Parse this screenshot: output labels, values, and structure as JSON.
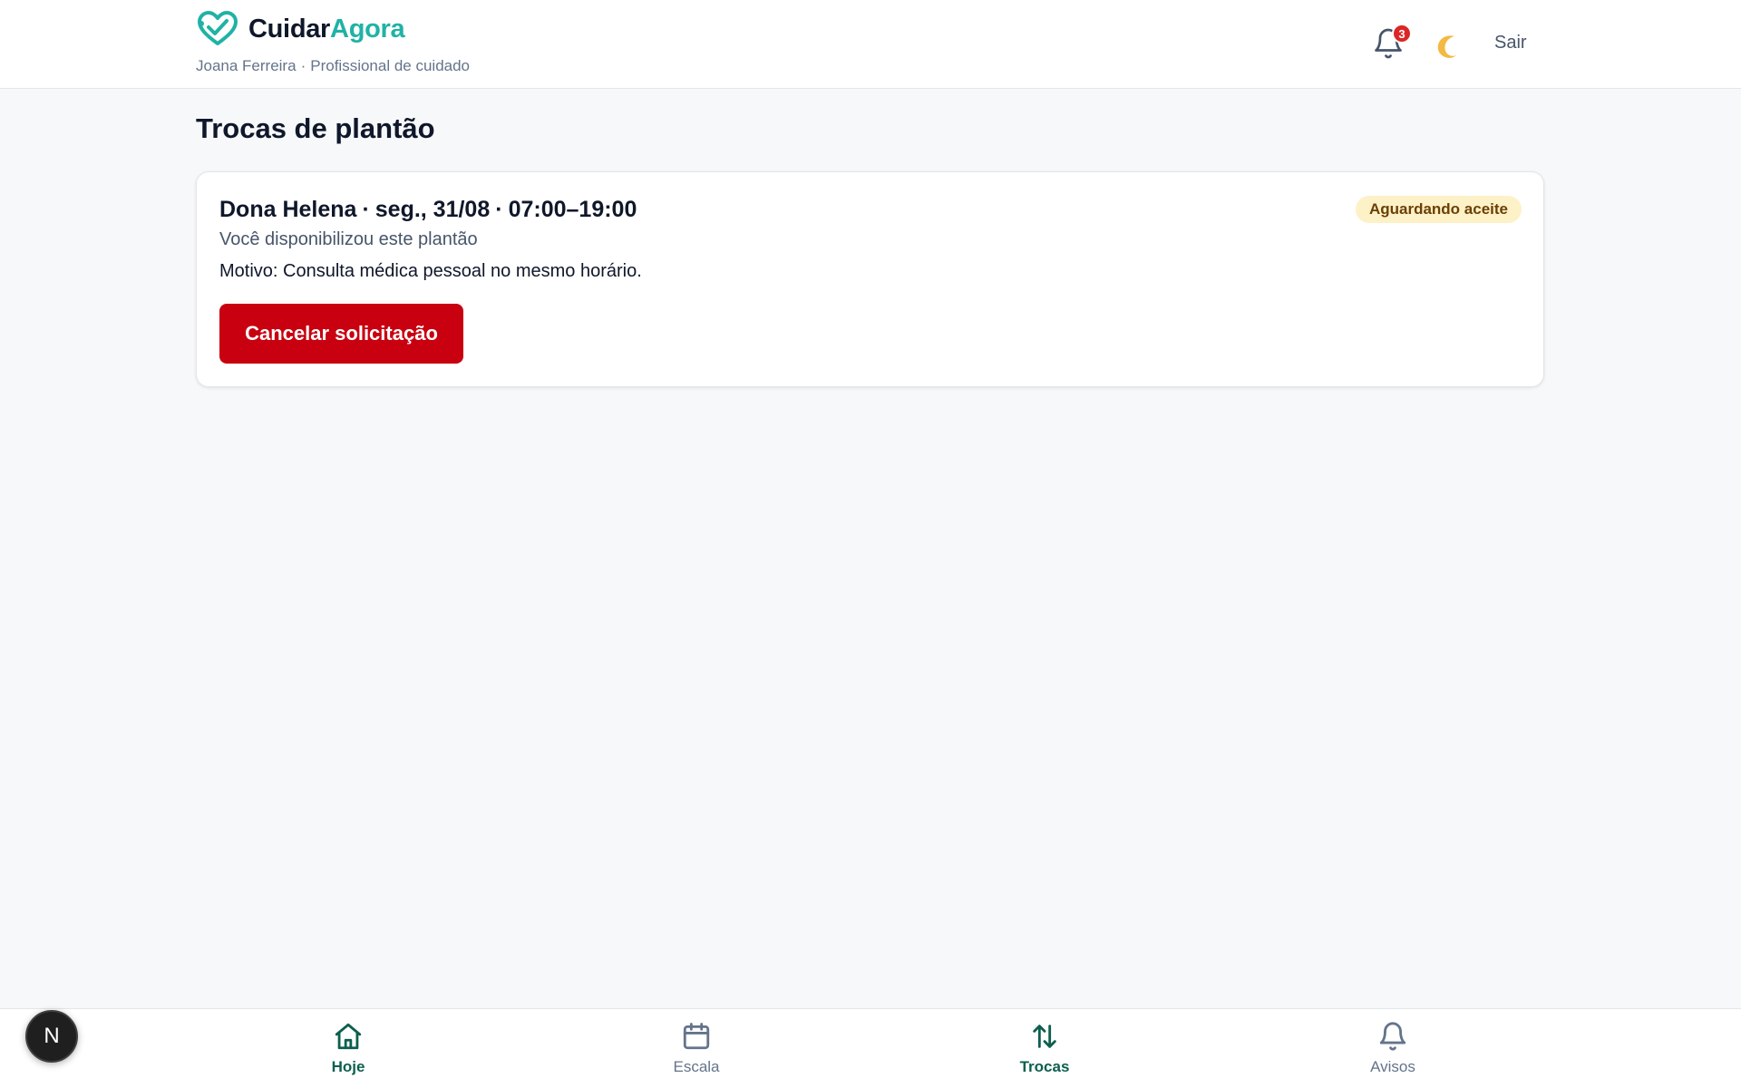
{
  "app": {
    "brand_part1": "Cuidar",
    "brand_part2": "Agora",
    "user_name": "Joana Ferreira",
    "user_separator": "·",
    "user_role": "Profissional de cuidado",
    "accent_color": "#20b2a6"
  },
  "header": {
    "notifications_count": "3",
    "theme_icon": "moon-icon",
    "logout_label": "Sair"
  },
  "page": {
    "title": "Trocas de plantão"
  },
  "swap_card": {
    "patient": "Dona Helena",
    "sep": "·",
    "date": "seg., 31/08",
    "time": "07:00–19:00",
    "status": "Aguardando aceite",
    "subtitle": "Você disponibilizou este plantão",
    "reason": "Motivo: Consulta médica pessoal no mesmo horário.",
    "cancel_label": "Cancelar solicitação",
    "cancel_color": "#c8000f",
    "status_color": "#fdf1c7"
  },
  "bottom_nav": {
    "items": [
      {
        "label": "Hoje",
        "icon": "home-icon"
      },
      {
        "label": "Escala",
        "icon": "calendar-icon"
      },
      {
        "label": "Trocas",
        "icon": "swap-arrows-icon"
      },
      {
        "label": "Avisos",
        "icon": "bell-icon"
      }
    ],
    "active_color": "#0d5f4f"
  },
  "dev_indicator": {
    "letter": "N"
  }
}
